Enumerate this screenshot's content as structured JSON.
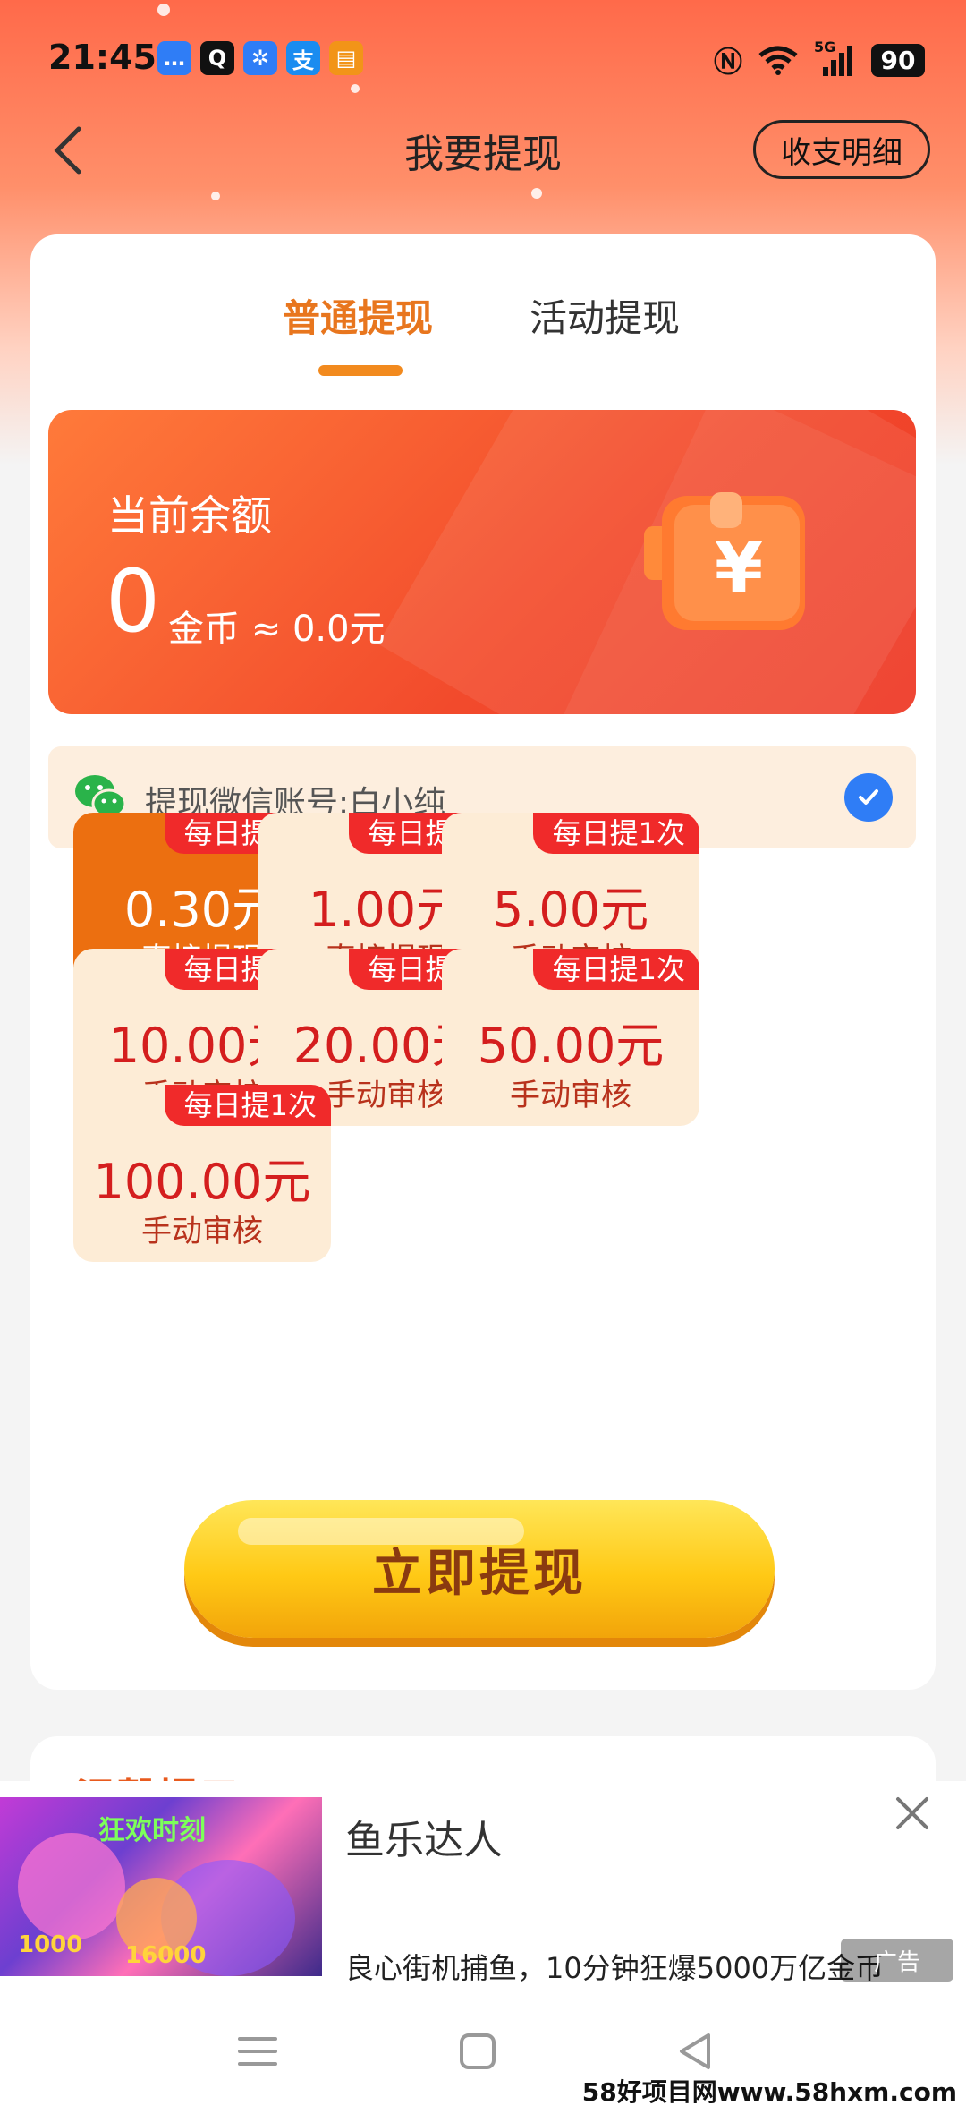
{
  "status_bar": {
    "time": "21:45",
    "app_icons": [
      {
        "name": "message-icon",
        "glyph": "…",
        "color": "#2f7df6"
      },
      {
        "name": "qq-icon",
        "glyph": "Q",
        "color": "#111111"
      },
      {
        "name": "pinwheel-app-icon",
        "glyph": "✲",
        "color": "#2f7df6"
      },
      {
        "name": "alipay-icon",
        "glyph": "支",
        "color": "#1a8cf0"
      },
      {
        "name": "book-app-icon",
        "glyph": "▤",
        "color": "#f29418"
      }
    ],
    "signal_label": "5G",
    "battery": "90"
  },
  "header": {
    "title": "我要提现",
    "records_button": "收支明细"
  },
  "tabs": [
    {
      "label": "普通提现",
      "active": true
    },
    {
      "label": "活动提现",
      "active": false
    }
  ],
  "balance": {
    "label": "当前余额",
    "coins": "0",
    "sub": "金币 ≈ 0.0元"
  },
  "account": {
    "text": "提现微信账号:白小纯",
    "checked": true
  },
  "options": [
    {
      "badge": "每日提2次",
      "amount": "0.30元",
      "mode": "直接提现",
      "selected": true
    },
    {
      "badge": "每日提1次",
      "amount": "1.00元",
      "mode": "直接提现",
      "selected": false
    },
    {
      "badge": "每日提1次",
      "amount": "5.00元",
      "mode": "手动审核",
      "selected": false
    },
    {
      "badge": "每日提1次",
      "amount": "10.00元",
      "mode": "手动审核",
      "selected": false
    },
    {
      "badge": "每日提1次",
      "amount": "20.00元",
      "mode": "手动审核",
      "selected": false
    },
    {
      "badge": "每日提1次",
      "amount": "50.00元",
      "mode": "手动审核",
      "selected": false
    },
    {
      "badge": "每日提1次",
      "amount": "100.00元",
      "mode": "手动审核",
      "selected": false
    }
  ],
  "withdraw_button": "立即提现",
  "tips_title": "温馨提示",
  "ad": {
    "title": "鱼乐达人",
    "description": "良心街机捕鱼，10分钟狂爆5000万亿金币",
    "tag": "广告",
    "thumb_text_top": "狂欢时刻",
    "thumb_text_1": "1000",
    "thumb_text_2": "16000"
  },
  "watermark": "58好项目网www.58hxm.com",
  "colors": {
    "accent": "#e8761e",
    "selected_option": "#ec6f10",
    "badge": "#f02a2a",
    "button_yellow": "#ffc915"
  }
}
